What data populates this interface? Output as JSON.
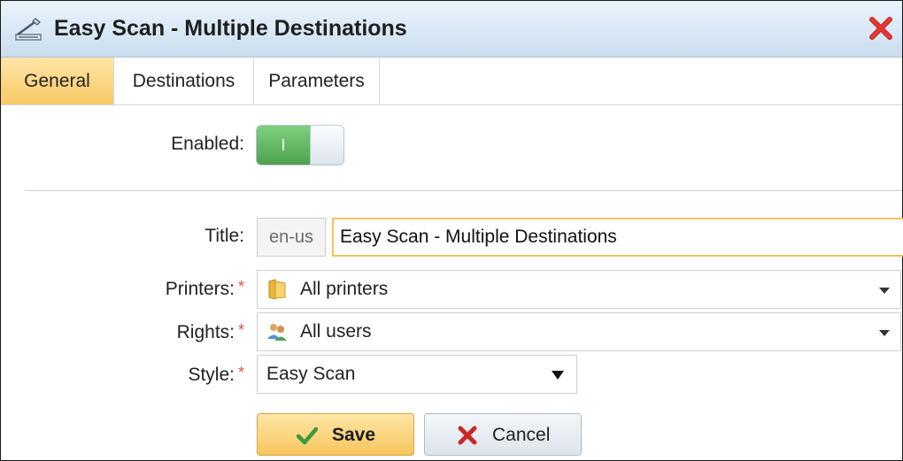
{
  "dialog": {
    "title": "Easy Scan - Multiple Destinations",
    "icon": "scanner-icon",
    "close_icon": "close-icon"
  },
  "tabs": [
    {
      "label": "General",
      "active": true
    },
    {
      "label": "Destinations",
      "active": false
    },
    {
      "label": "Parameters",
      "active": false
    }
  ],
  "form": {
    "enabled": {
      "label": "Enabled:",
      "toggle_text": "I",
      "value": true
    },
    "title": {
      "label": "Title:",
      "locale": "en-us",
      "value": "Easy Scan - Multiple Destinations"
    },
    "printers": {
      "label": "Printers:",
      "required_mark": "*",
      "value": "All printers",
      "icon": "folder-icon"
    },
    "rights": {
      "label": "Rights:",
      "required_mark": "*",
      "value": "All users",
      "icon": "users-icon"
    },
    "style": {
      "label": "Style:",
      "required_mark": "*",
      "value": "Easy Scan"
    }
  },
  "buttons": {
    "save": {
      "label": "Save",
      "icon": "checkmark-icon"
    },
    "cancel": {
      "label": "Cancel",
      "icon": "x-icon"
    }
  },
  "colors": {
    "active_tab": "#f9c964",
    "toggle_on": "#5aad5a",
    "focus_border": "#f2c35c",
    "required": "#d9534f",
    "close": "#d32f2f"
  }
}
